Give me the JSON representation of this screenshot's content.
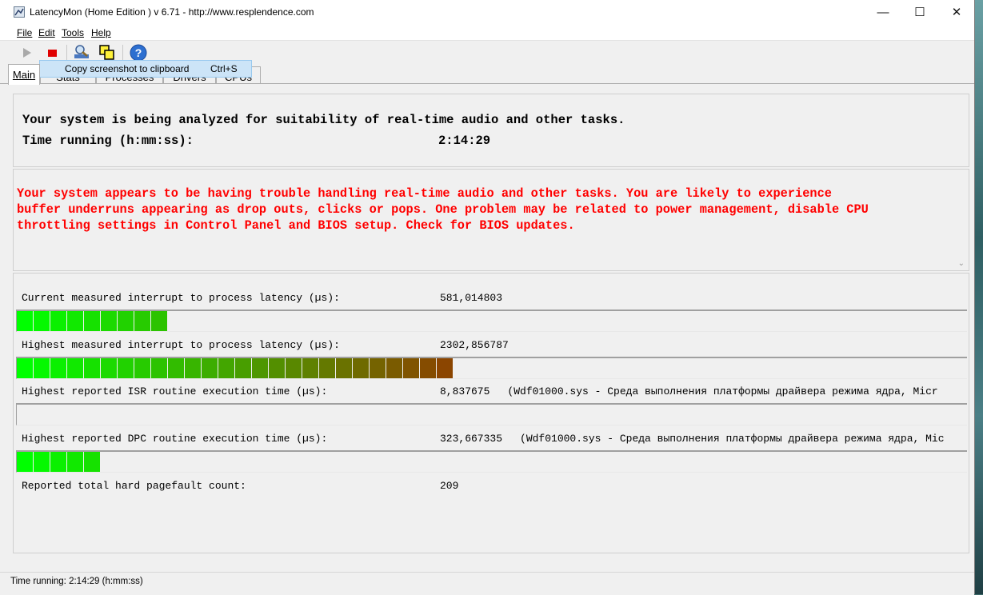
{
  "window": {
    "title": "LatencyMon  (Home Edition )  v 6.71 - http://www.resplendence.com",
    "minimize_icon": "—",
    "maximize_icon": "☐",
    "close_icon": "✕"
  },
  "menu": [
    "File",
    "Edit",
    "Tools",
    "Help"
  ],
  "toolbar": {
    "tooltip_label": "Copy screenshot to clipboard",
    "tooltip_shortcut": "Ctrl+S"
  },
  "tabs": [
    "Main",
    "Stats",
    "Processes",
    "Drivers",
    "CPUs"
  ],
  "intro": {
    "line1": "Your system is being analyzed for suitability of real-time audio and other tasks.",
    "line2_label": "Time running (h:mm:ss):",
    "line2_value": "2:14:29"
  },
  "warning": "Your system appears to be having trouble handling real-time audio and other tasks. You are likely to experience\nbuffer underruns appearing as drop outs, clicks or pops. One problem may be related to power management, disable CPU\nthrottling settings in Control Panel and BIOS setup. Check for BIOS updates.",
  "metrics": [
    {
      "label": "Current measured interrupt to process latency (µs):",
      "value": "581,014803",
      "driver": ""
    },
    {
      "label": "Highest measured interrupt to process latency (µs):",
      "value": "2302,856787",
      "driver": ""
    },
    {
      "label": "Highest reported ISR routine execution time (µs):",
      "value": "8,837675",
      "driver": "(Wdf01000.sys - Среда выполнения платформы драйвера режима ядра, Micr"
    },
    {
      "label": "Highest reported DPC routine execution time (µs):",
      "value": "323,667335",
      "driver": "(Wdf01000.sys - Среда выполнения платформы драйвера режима ядра, Mic"
    },
    {
      "label": "Reported total hard pagefault count:",
      "value": "209",
      "driver": ""
    }
  ],
  "bars": [
    {
      "metric": "current_latency",
      "segments": 9
    },
    {
      "metric": "highest_latency",
      "segments": 26
    },
    {
      "metric": "isr_time",
      "segments": 0
    },
    {
      "metric": "dpc_time",
      "segments": 5
    }
  ],
  "colors": {
    "warning_text": "#ff0000",
    "bar_start": "#00ff00",
    "bar_end": "#8b4500"
  },
  "status": "Time running: 2:14:29  (h:mm:ss)"
}
